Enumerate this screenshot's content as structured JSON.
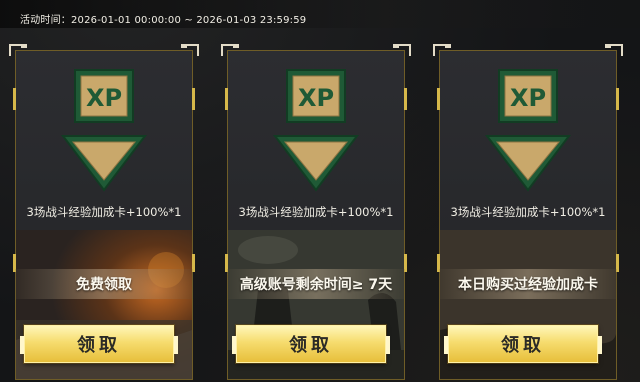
{
  "activity_time_label": "活动时间：2026-01-01 00:00:00 ~ 2026-01-03 23:59:59",
  "cards": [
    {
      "icon_text": "XP",
      "reward": "3场战斗经验加成卡+100%*1",
      "condition": "免费领取",
      "button": "领取",
      "scene": "fire-battlefield"
    },
    {
      "icon_text": "XP",
      "reward": "3场战斗经验加成卡+100%*1",
      "condition": "高级账号剩余时间≥ 7天",
      "button": "领取",
      "scene": "soldiers-forest"
    },
    {
      "icon_text": "XP",
      "reward": "3场战斗经验加成卡+100%*1",
      "condition": "本日购买过经验加成卡",
      "button": "领取",
      "scene": "sniper-ruins"
    }
  ],
  "colors": {
    "badge_green": "#1f5a36",
    "badge_gold": "#c9a86b",
    "frame_gold": "#6f5d27",
    "button_gold": "#f6dc6e"
  }
}
